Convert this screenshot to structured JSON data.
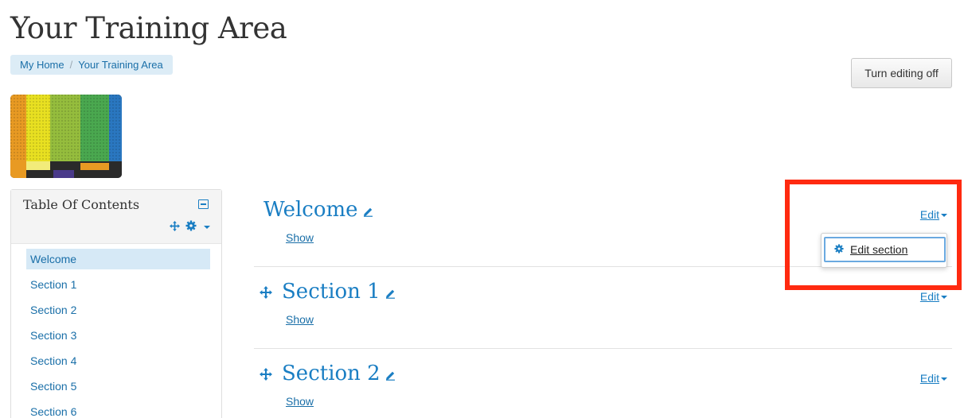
{
  "page": {
    "title": "Your Training Area"
  },
  "breadcrumb": [
    {
      "label": "My Home"
    },
    {
      "label": "Your Training Area"
    }
  ],
  "actions": {
    "editing_toggle_label": "Turn editing off"
  },
  "toc": {
    "title": "Table Of Contents",
    "items": [
      {
        "label": "Welcome",
        "active": true
      },
      {
        "label": "Section 1",
        "active": false
      },
      {
        "label": "Section 2",
        "active": false
      },
      {
        "label": "Section 3",
        "active": false
      },
      {
        "label": "Section 4",
        "active": false
      },
      {
        "label": "Section 5",
        "active": false
      },
      {
        "label": "Section 6",
        "active": false
      }
    ]
  },
  "sections": [
    {
      "title": "Welcome",
      "show_label": "Show",
      "edit_label": "Edit",
      "movable": false
    },
    {
      "title": "Section 1",
      "show_label": "Show",
      "edit_label": "Edit",
      "movable": true
    },
    {
      "title": "Section 2",
      "show_label": "Show",
      "edit_label": "Edit",
      "movable": true
    }
  ],
  "dropdown": {
    "item_label": "Edit section",
    "icon": "gear-icon"
  },
  "colors": {
    "accent": "#1a7ec3",
    "link": "#1a6fa8",
    "breadcrumb_bg": "#dcecf6",
    "active_item_bg": "#d6e9f6",
    "highlight": "#ff2a10"
  },
  "course_image": {
    "icon": "color-bars-image"
  }
}
